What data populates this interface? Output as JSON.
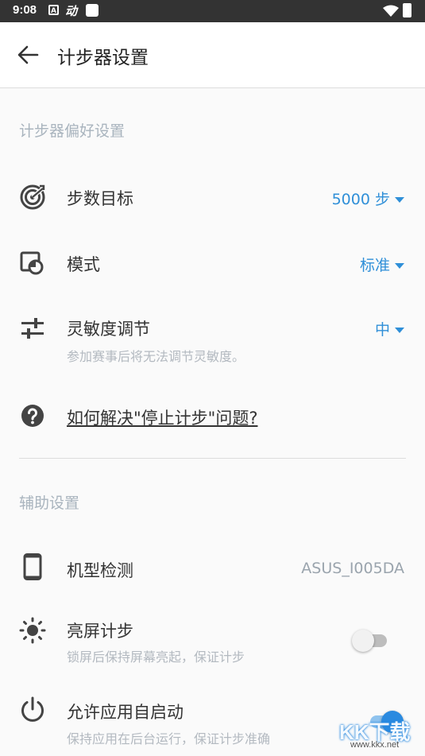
{
  "status_bar": {
    "time": "9:08",
    "app_icon_letter": "A",
    "app_glyph": "动"
  },
  "header": {
    "title": "计步器设置"
  },
  "section_pedometer": {
    "title": "计步器偏好设置",
    "step_goal": {
      "label": "步数目标",
      "value": "5000 步"
    },
    "mode": {
      "label": "模式",
      "value": "标准"
    },
    "sensitivity": {
      "label": "灵敏度调节",
      "value": "中",
      "sub": "参加赛事后将无法调节灵敏度。"
    },
    "help": {
      "label": "如何解决\"停止计步\"问题?"
    }
  },
  "section_assist": {
    "title": "辅助设置",
    "device": {
      "label": "机型检测",
      "value": "ASUS_I005DA"
    },
    "screen_on": {
      "label": "亮屏计步",
      "sub": "锁屏后保持屏幕亮起，保证计步",
      "enabled": false
    },
    "autostart": {
      "label": "允许应用自启动",
      "sub": "保持应用在后台运行，保证计步准确",
      "enabled": true
    }
  },
  "watermark": {
    "text": "KK下载",
    "url": "www.kkx.net"
  },
  "colors": {
    "accent": "#2f8fd8",
    "status_bar": "#333333",
    "section_title": "#a9b4be"
  }
}
